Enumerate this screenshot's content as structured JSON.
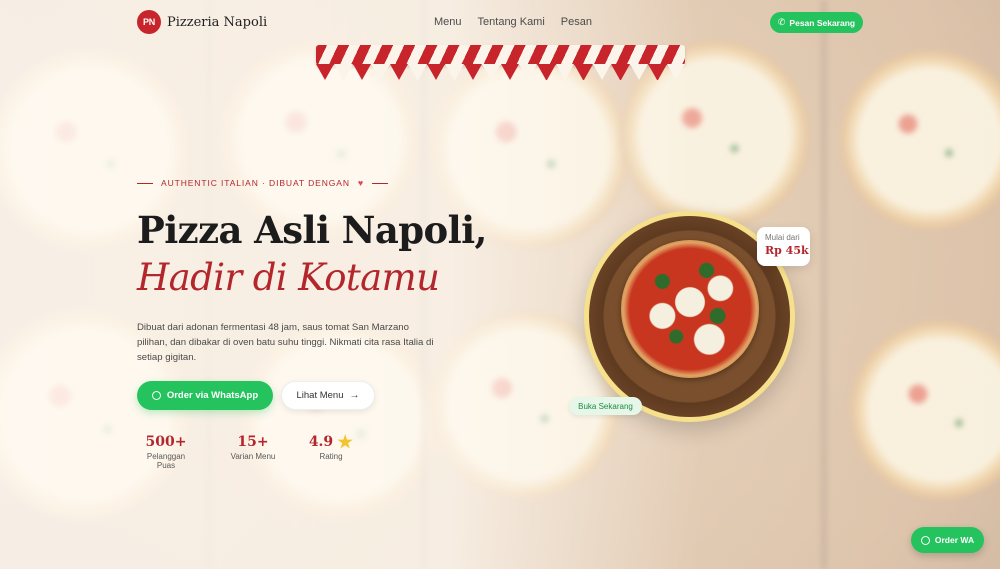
{
  "brand": {
    "logo_text": "PN",
    "name": "Pizzeria Napoli"
  },
  "nav": {
    "items": [
      "Menu",
      "Tentang Kami",
      "Pesan"
    ],
    "cta": "Pesan Sekarang"
  },
  "hero": {
    "eyebrow": "AUTHENTIC ITALIAN · DIBUAT DENGAN",
    "title_line1": "Pizza Asli Napoli,",
    "title_line2": "Hadir di Kotamu",
    "description": "Dibuat dari adonan fermentasi 48 jam, saus tomat San Marzano pilihan, dan dibakar di oven batu suhu tinggi. Nikmati cita rasa Italia di setiap gigitan.",
    "cta_whatsapp": "Order via WhatsApp",
    "cta_menu": "Lihat Menu"
  },
  "stats": [
    {
      "value": "500+",
      "label": "Pelanggan Puas"
    },
    {
      "value": "15+",
      "label": "Varian Menu"
    },
    {
      "value": "4.9",
      "label": "Rating"
    }
  ],
  "price_badge": {
    "label": "Mulai dari",
    "price": "Rp 45k"
  },
  "open_badge": "Buka Sekarang",
  "fab_label": "Order WA",
  "colors": {
    "accent_red": "#b3262c",
    "whatsapp_green": "#25c35e",
    "ring_yellow": "#f6e08c"
  },
  "icons": {
    "heart": "heart-icon",
    "phone": "phone-icon",
    "whatsapp": "whatsapp-icon",
    "arrow": "arrow-right-icon",
    "star": "star-icon"
  }
}
